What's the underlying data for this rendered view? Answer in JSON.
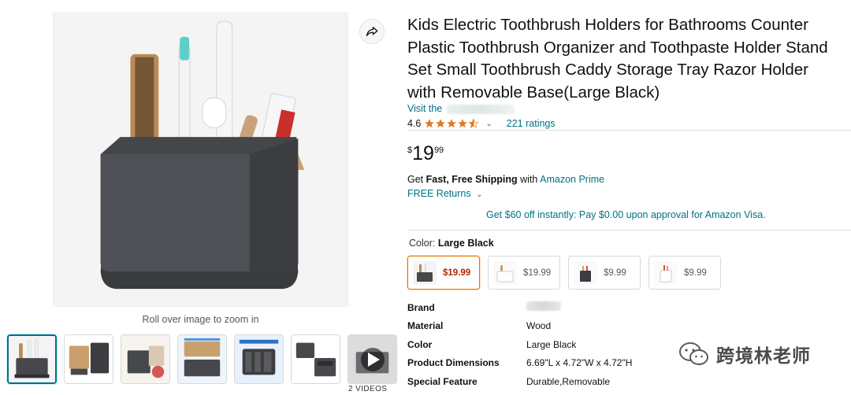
{
  "product": {
    "title": "Kids Electric Toothbrush Holders for Bathrooms Counter Plastic Toothbrush Organizer and Toothpaste Holder Stand Set Small Toothbrush Caddy Storage Tray Razor Holder with Removable Base(Large Black)",
    "visit_prefix": "Visit the",
    "rating_value": "4.6",
    "stars": 4.5,
    "ratings_count": "221 ratings",
    "price_symbol": "$",
    "price_whole": "19",
    "price_fraction": "99"
  },
  "gallery": {
    "zoom_hint": "Roll over image to zoom in",
    "videos_caption": "2 VIDEOS"
  },
  "delivery": {
    "get": "Get ",
    "fast_free": "Fast, Free Shipping",
    "with": " with ",
    "prime": "Amazon Prime",
    "returns": "FREE Returns",
    "visa_offer": "Get $60 off instantly: Pay $0.00 upon approval for Amazon Visa."
  },
  "variants": {
    "label": "Color: ",
    "selected_name": "Large Black",
    "options": [
      {
        "price": "$19.99"
      },
      {
        "price": "$19.99"
      },
      {
        "price": "$9.99"
      },
      {
        "price": "$9.99"
      }
    ]
  },
  "specs": [
    {
      "key": "Brand",
      "value": ""
    },
    {
      "key": "Material",
      "value": "Wood"
    },
    {
      "key": "Color",
      "value": "Large Black"
    },
    {
      "key": "Product Dimensions",
      "value": "6.69\"L x 4.72\"W x 4.72\"H"
    },
    {
      "key": "Special Feature",
      "value": "Durable,Removable"
    }
  ],
  "watermark": {
    "text": "跨境林老师"
  },
  "colors": {
    "link": "#007185",
    "price_selected": "#b12704",
    "star": "#de7921",
    "selected_border": "#e77600"
  }
}
